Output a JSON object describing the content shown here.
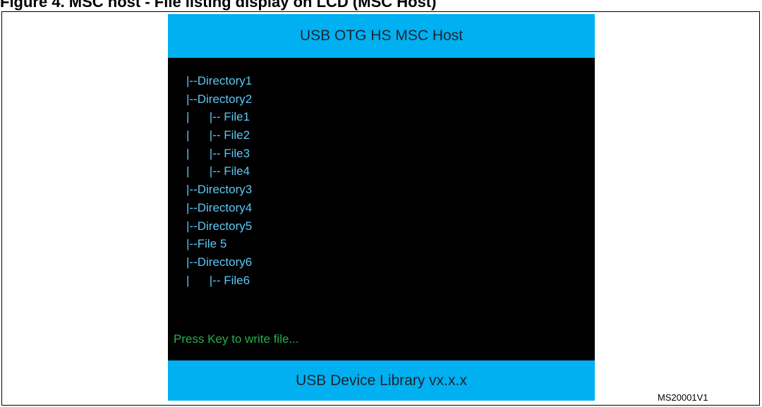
{
  "caption": "Figure 4.  MSC host - File listing display on LCD (MSC Host)",
  "colors": {
    "bar_background": "#00b0f0",
    "screen_background": "#000000",
    "tree_text": "#5bc8f5",
    "status_text": "#22b14c",
    "bar_text": "#1b2530"
  },
  "header": {
    "title": "USB OTG HS MSC Host"
  },
  "tree": {
    "lines": [
      "|--Directory1",
      "|--Directory2",
      "|      |-- File1",
      "|      |-- File2",
      "|      |-- File3",
      "|      |-- File4",
      "|--Directory3",
      "|--Directory4",
      "|--Directory5",
      "|--File 5",
      "|--Directory6",
      "|      |-- File6"
    ]
  },
  "status": {
    "message": "Press Key to write file..."
  },
  "footer": {
    "text": "USB Device Library vx.x.x"
  },
  "figure_id": "MS20001V1"
}
